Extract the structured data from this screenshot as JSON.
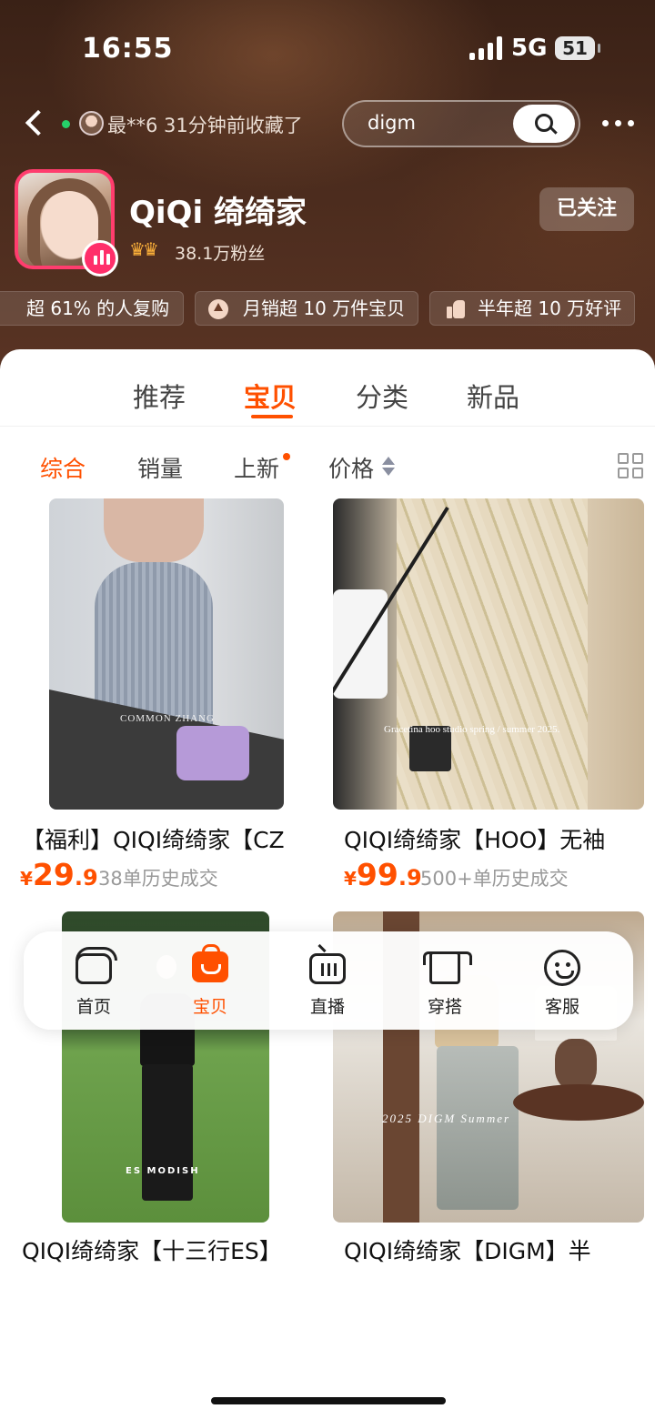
{
  "status_bar": {
    "time": "16:55",
    "network": "5G",
    "battery": "51"
  },
  "top_nav": {
    "collect_notice": "最**6 31分钟前收藏了",
    "search_value": "digm"
  },
  "shop": {
    "name": "QiQi 绮绮家",
    "fans": "38.1万粉丝",
    "follow_label": "已关注",
    "highlights": [
      "超 61% 的人复购",
      "月销超 10 万件宝贝",
      "半年超 10 万好评"
    ]
  },
  "tabs": [
    {
      "label": "推荐",
      "active": false
    },
    {
      "label": "宝贝",
      "active": true
    },
    {
      "label": "分类",
      "active": false
    },
    {
      "label": "新品",
      "active": false
    }
  ],
  "sort_options": [
    {
      "label": "综合",
      "active": true
    },
    {
      "label": "销量",
      "active": false
    },
    {
      "label": "上新",
      "active": false
    },
    {
      "label": "价格",
      "active": false
    }
  ],
  "products": [
    {
      "title": "【福利】QIQI绮绮家【CZ",
      "price_yen": "¥",
      "price_int": "29",
      "price_dec": ".9",
      "sold": "38单历史成交",
      "image_text": "COMMON ZHANG"
    },
    {
      "title": "QIQI绮绮家【HOO】无袖",
      "price_yen": "¥",
      "price_int": "99",
      "price_dec": ".9",
      "sold": "500+单历史成交",
      "image_text": "Gracetina hoo   studio   spring / summer   2025."
    },
    {
      "title": "QIQI绮绮家【十三行ES】",
      "image_text": "ES MODISH"
    },
    {
      "title": "QIQI绮绮家【DIGM】半",
      "image_text": "2025   DIGM   Summer"
    }
  ],
  "bottom_nav": [
    {
      "label": "首页",
      "icon": "home-icon",
      "active": false
    },
    {
      "label": "宝贝",
      "icon": "bag-icon",
      "active": true
    },
    {
      "label": "直播",
      "icon": "tv-icon",
      "active": false
    },
    {
      "label": "穿搭",
      "icon": "shirt-icon",
      "active": false
    },
    {
      "label": "客服",
      "icon": "face-icon",
      "active": false
    }
  ],
  "colors": {
    "accent": "#ff5000",
    "header_bg": "#4a2b1d",
    "live_pink": "#ff2e6a"
  }
}
